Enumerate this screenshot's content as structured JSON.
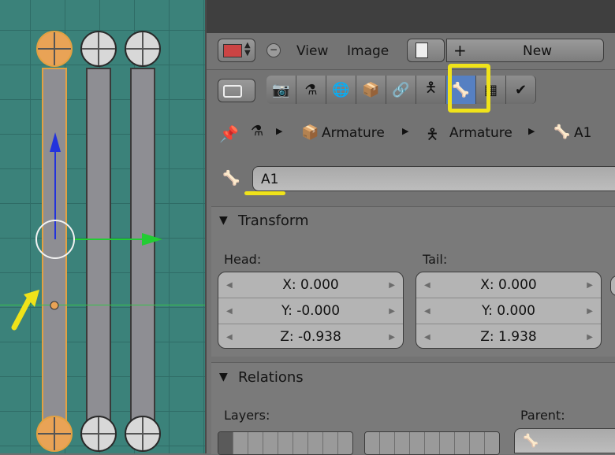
{
  "header": {
    "menu": [
      {
        "label": "View"
      },
      {
        "label": "Image"
      }
    ],
    "new_button": "New"
  },
  "breadcrumb": {
    "items": [
      {
        "label": "Armature"
      },
      {
        "label": "Armature"
      },
      {
        "label": "A1"
      }
    ]
  },
  "bone_name": {
    "value": "A1"
  },
  "transform": {
    "title": "Transform",
    "head_label": "Head:",
    "tail_label": "Tail:",
    "head": {
      "x": "X: 0.000",
      "y": "Y: -0.000",
      "z": "Z: -0.938"
    },
    "tail": {
      "x": "X: 0.000",
      "y": "Y: 0.000",
      "z": "Z: 1.938"
    }
  },
  "relations": {
    "title": "Relations",
    "layers_label": "Layers:",
    "parent_label": "Parent:"
  },
  "colors": {
    "highlight": "#f0e31a",
    "selected_outline": "#e2a142",
    "active_tab": "#5680c2"
  }
}
